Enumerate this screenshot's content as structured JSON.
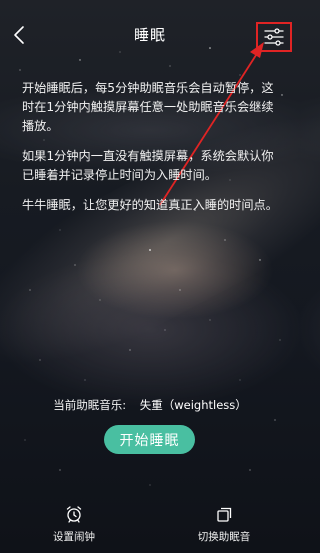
{
  "header": {
    "title": "睡眠"
  },
  "description": {
    "paragraphs": [
      "开始睡眠后，每5分钟助眠音乐会自动暂停，这时在1分钟内触摸屏幕任意一处助眠音乐会继续播放。",
      "如果1分钟内一直没有触摸屏幕，系统会默认你已睡着并记录停止时间为入睡时间。",
      "牛牛睡眠，让您更好的知道真正入睡的时间点。"
    ]
  },
  "music": {
    "label": "当前助眠音乐:",
    "value": "失重（weightless）"
  },
  "start_button": {
    "label": "开始睡眠"
  },
  "bottom_bar": {
    "alarm_label": "设置闹钟",
    "switch_label": "切换助眠音"
  },
  "colors": {
    "accent": "#49bfa1",
    "annotation": "#e02424"
  }
}
